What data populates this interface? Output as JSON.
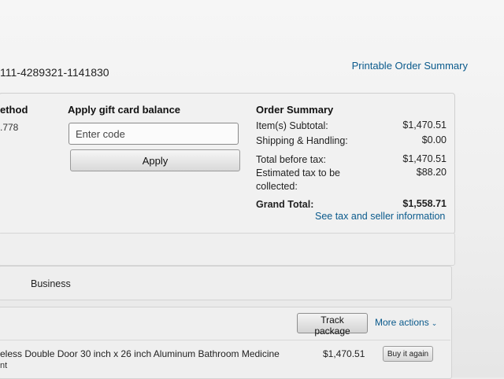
{
  "order": {
    "number": "111-4289321-1141830",
    "printable_link": "Printable Order Summary"
  },
  "payment_method": {
    "title": "ethod",
    "value": ".778"
  },
  "gift_card": {
    "title": "Apply gift card balance",
    "placeholder": "Enter code",
    "apply_label": "Apply"
  },
  "order_summary": {
    "title": "Order Summary",
    "rows": [
      {
        "label": "Item(s) Subtotal:",
        "value": "$1,470.51"
      },
      {
        "label": "Shipping & Handling:",
        "value": "$0.00"
      },
      {
        "label": "Total before tax:",
        "value": "$1,470.51"
      },
      {
        "label": "Estimated tax to be collected:",
        "value": "$88.20"
      },
      {
        "label": "Grand Total:",
        "value": "$1,558.71"
      }
    ],
    "tax_link": "See tax and seller information"
  },
  "business": {
    "label": "Business"
  },
  "shipment": {
    "track_label": "Track package",
    "more_actions_label": "More actions",
    "item_title": "eless Double Door 30 inch x 26 inch Aluminum Bathroom Medicine",
    "item_title_2": "nt",
    "item_price": "$1,470.51",
    "buy_again_label": "Buy it again"
  },
  "colors": {
    "link": "#0a5a8c",
    "background": "#ececec"
  }
}
